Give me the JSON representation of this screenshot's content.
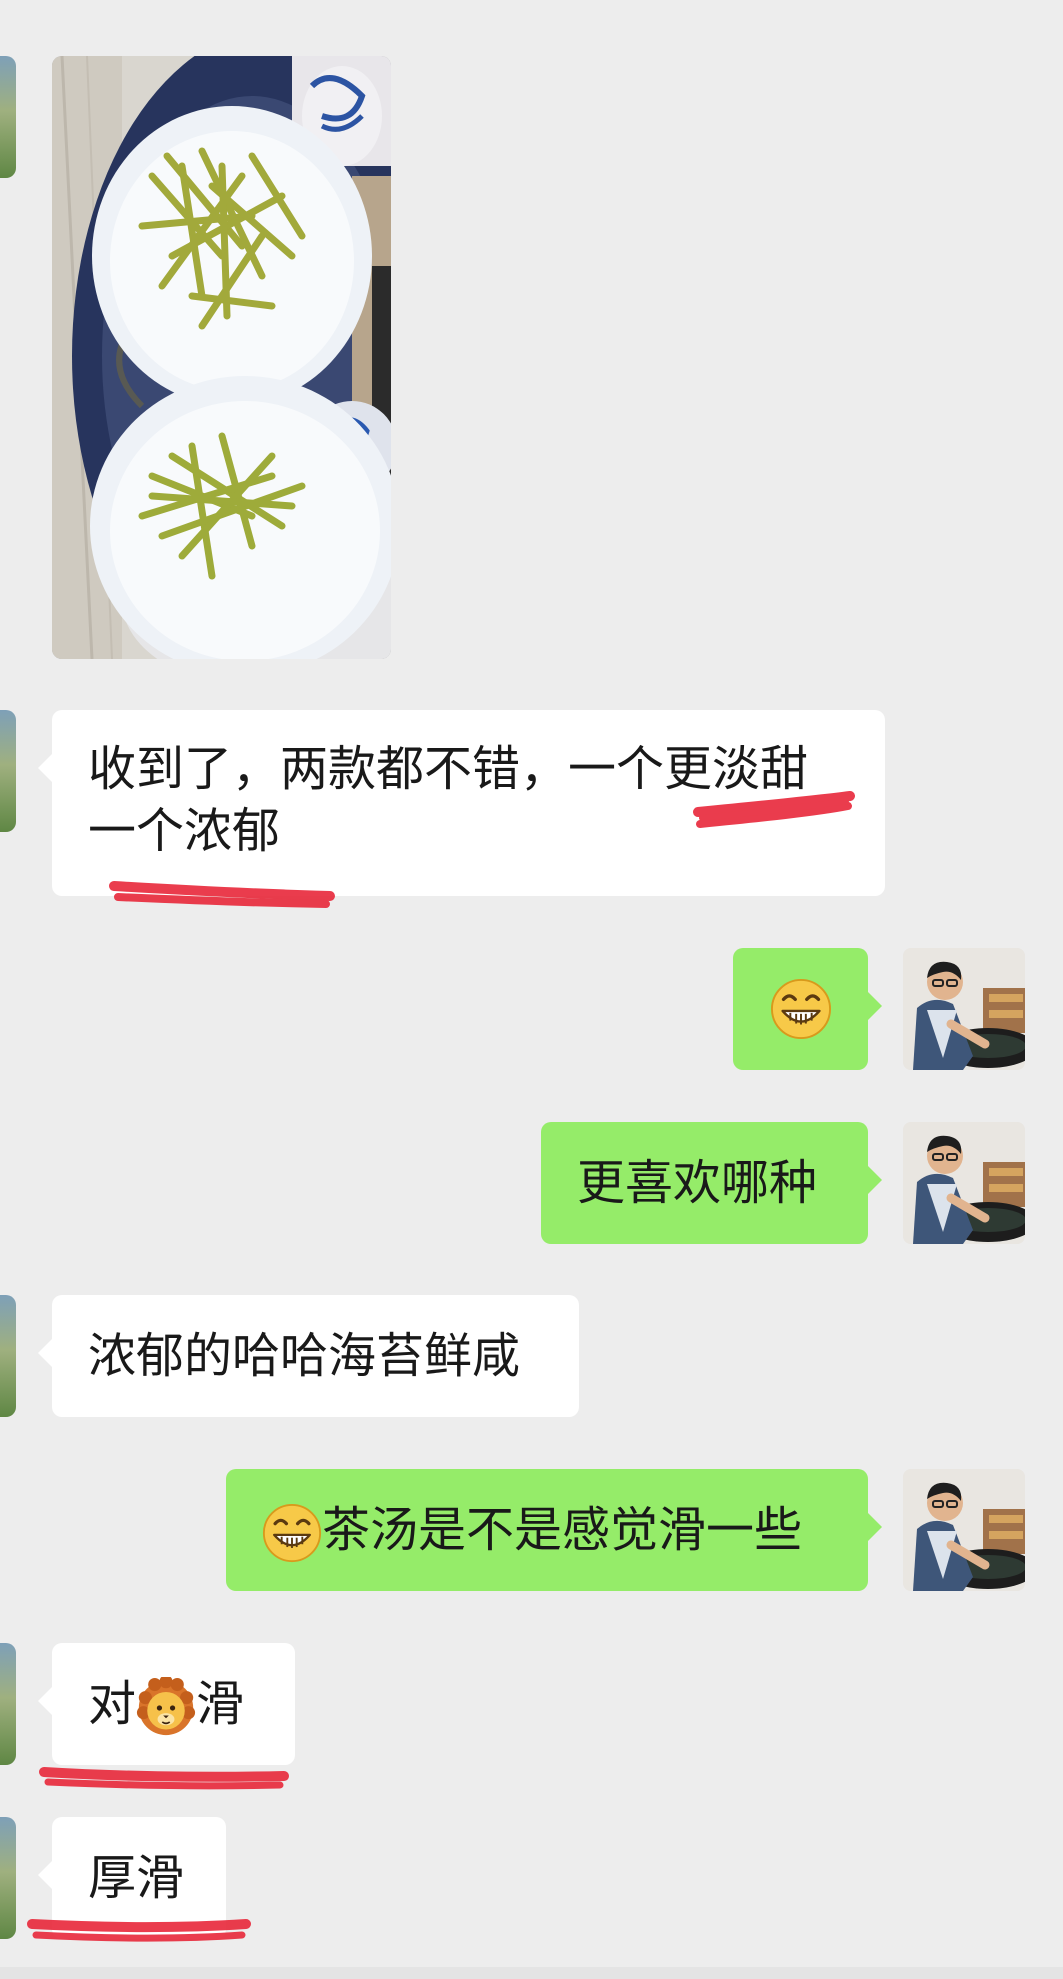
{
  "chat": {
    "messages": [
      {
        "side": "in",
        "type": "image",
        "image_alt": "tea leaves in two white bowls"
      },
      {
        "side": "in",
        "type": "text",
        "line1": "收到了，两款都不错，一个更淡甜",
        "line2": "一个浓郁"
      },
      {
        "side": "out",
        "type": "emoji",
        "emoji": "grinning-face"
      },
      {
        "side": "out",
        "type": "text",
        "text": "更喜欢哪种"
      },
      {
        "side": "in",
        "type": "text",
        "text": "浓郁的哈哈海苔鲜咸"
      },
      {
        "side": "out",
        "type": "text",
        "emoji": "grinning-face",
        "text": "茶汤是不是感觉滑一些"
      },
      {
        "side": "in",
        "type": "text",
        "before": "对",
        "emoji": "lion-face",
        "after": "滑"
      },
      {
        "side": "in",
        "type": "text",
        "text": "厚滑"
      }
    ]
  },
  "colors": {
    "background": "#ededed",
    "incoming_bubble": "#ffffff",
    "outgoing_bubble": "#95ec69",
    "annotation_ink": "#e8283a"
  },
  "annotations": "red hand-drawn underlines beneath 更淡甜, 一个浓郁, 对滑 and 厚滑"
}
